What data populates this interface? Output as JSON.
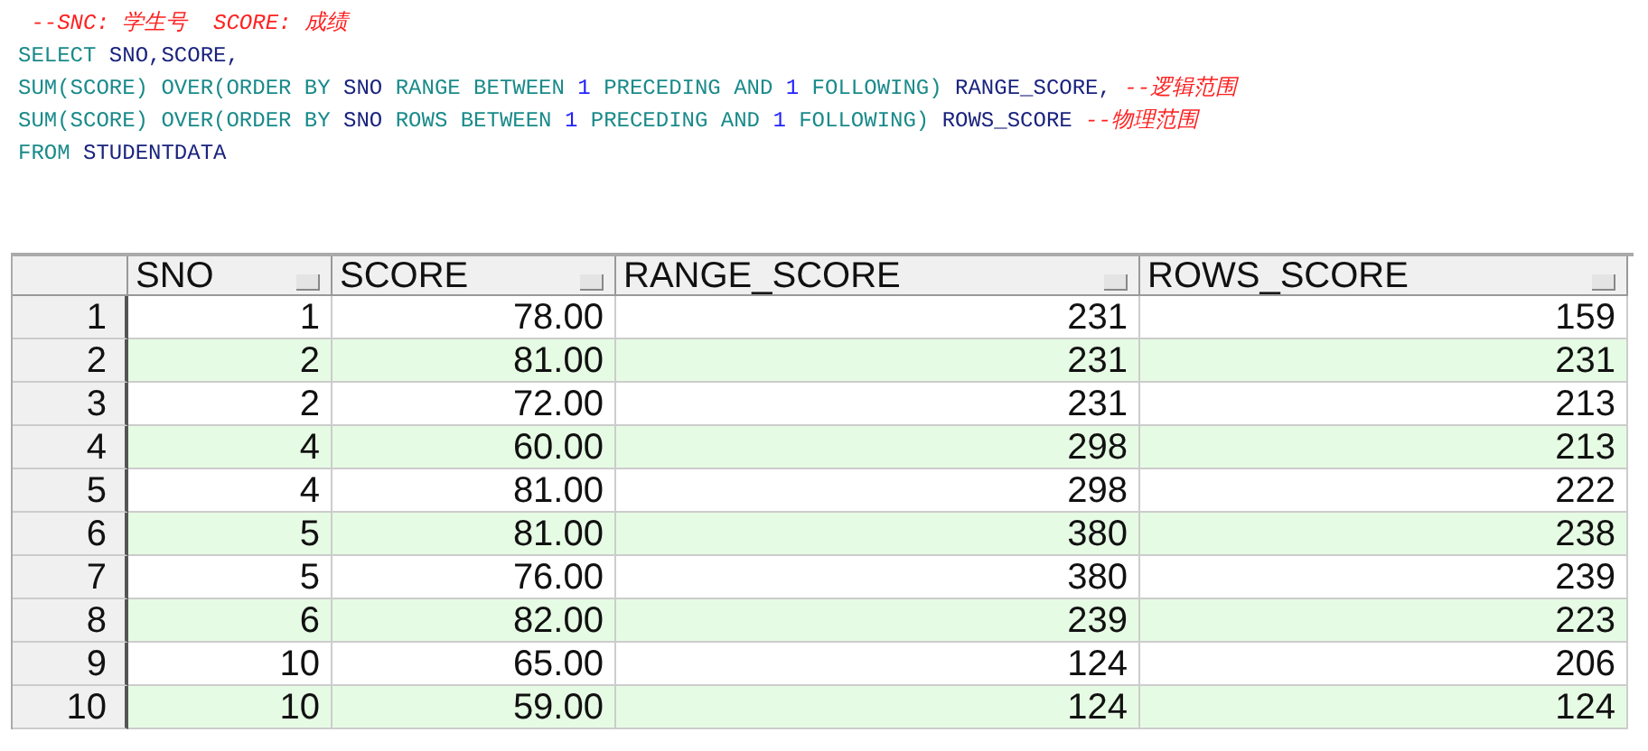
{
  "editor": {
    "lines": [
      [
        {
          "kind": "comment",
          "text": " --SNC: 学生号  SCORE: 成绩"
        }
      ],
      [
        {
          "kind": "keyword",
          "text": "SELECT "
        },
        {
          "kind": "ident",
          "text": "SNO,SCORE,"
        }
      ],
      [
        {
          "kind": "keyword",
          "text": "SUM(SCORE) OVER(ORDER BY "
        },
        {
          "kind": "ident",
          "text": "SNO "
        },
        {
          "kind": "keyword",
          "text": "RANGE BETWEEN "
        },
        {
          "kind": "number",
          "text": "1"
        },
        {
          "kind": "keyword",
          "text": " PRECEDING AND "
        },
        {
          "kind": "number",
          "text": "1"
        },
        {
          "kind": "keyword",
          "text": " FOLLOWING) "
        },
        {
          "kind": "ident",
          "text": "RANGE_SCORE, "
        },
        {
          "kind": "comment",
          "text": "--逻辑范围"
        }
      ],
      [
        {
          "kind": "keyword",
          "text": "SUM(SCORE) OVER(ORDER BY "
        },
        {
          "kind": "ident",
          "text": "SNO "
        },
        {
          "kind": "keyword",
          "text": "ROWS BETWEEN "
        },
        {
          "kind": "number",
          "text": "1"
        },
        {
          "kind": "keyword",
          "text": " PRECEDING AND "
        },
        {
          "kind": "number",
          "text": "1"
        },
        {
          "kind": "keyword",
          "text": " FOLLOWING) "
        },
        {
          "kind": "ident",
          "text": "ROWS_SCORE "
        },
        {
          "kind": "comment",
          "text": "--物理范围"
        }
      ],
      [
        {
          "kind": "keyword",
          "text": "FROM "
        },
        {
          "kind": "ident",
          "text": "STUDENTDATA"
        }
      ]
    ]
  },
  "table": {
    "columns": [
      "SNO",
      "SCORE",
      "RANGE_SCORE",
      "ROWS_SCORE"
    ],
    "rows": [
      {
        "number": "1",
        "cells": [
          "1",
          "78.00",
          "231",
          "159"
        ]
      },
      {
        "number": "2",
        "cells": [
          "2",
          "81.00",
          "231",
          "231"
        ]
      },
      {
        "number": "3",
        "cells": [
          "2",
          "72.00",
          "231",
          "213"
        ]
      },
      {
        "number": "4",
        "cells": [
          "4",
          "60.00",
          "298",
          "213"
        ]
      },
      {
        "number": "5",
        "cells": [
          "4",
          "81.00",
          "298",
          "222"
        ]
      },
      {
        "number": "6",
        "cells": [
          "5",
          "81.00",
          "380",
          "238"
        ]
      },
      {
        "number": "7",
        "cells": [
          "5",
          "76.00",
          "380",
          "239"
        ]
      },
      {
        "number": "8",
        "cells": [
          "6",
          "82.00",
          "239",
          "223"
        ]
      },
      {
        "number": "9",
        "cells": [
          "10",
          "65.00",
          "124",
          "206"
        ]
      },
      {
        "number": "10",
        "cells": [
          "10",
          "59.00",
          "124",
          "124"
        ]
      }
    ]
  }
}
